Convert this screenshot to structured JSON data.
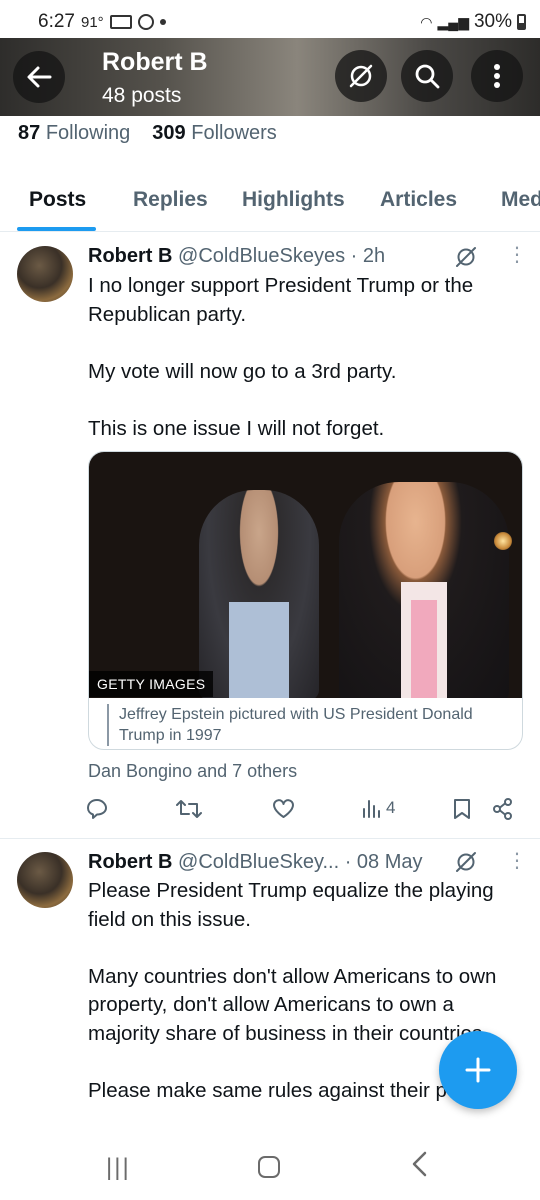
{
  "status_bar": {
    "time": "6:27",
    "temp": "91°",
    "battery": "30%"
  },
  "header": {
    "name": "Robert B",
    "posts_count": "48 posts"
  },
  "profile": {
    "following_count": "87",
    "following_label": "Following",
    "followers_count": "309",
    "followers_label": "Followers"
  },
  "tabs": [
    {
      "label": "Posts"
    },
    {
      "label": "Replies"
    },
    {
      "label": "Highlights"
    },
    {
      "label": "Articles"
    },
    {
      "label": "Media"
    }
  ],
  "posts": [
    {
      "name": "Robert B",
      "handle": "@ColdBlueSkeyes",
      "time": "· 2h",
      "paragraphs": [
        "I no longer support President Trump or the Republican party.",
        "My vote will now go to a 3rd party.",
        "This is one issue I will not forget."
      ],
      "media_badge": "GETTY IMAGES",
      "media_caption": "Jeffrey Epstein pictured with US President Donald Trump in 1997",
      "liked_by": "Dan Bongino and 7 others",
      "views": "4"
    },
    {
      "name": "Robert B",
      "handle": "@ColdBlueSkey...",
      "time": "· 08 May",
      "paragraphs": [
        "Please President Trump equalize the playing field on this issue.",
        "Many countries don't allow Americans to own property, don't allow Americans to own a majority share of business in their countries.",
        "Please make same rules against their people"
      ]
    }
  ],
  "colors": {
    "accent": "#1d9bf0",
    "secondary_text": "#536471",
    "primary_text": "#0f1419"
  }
}
